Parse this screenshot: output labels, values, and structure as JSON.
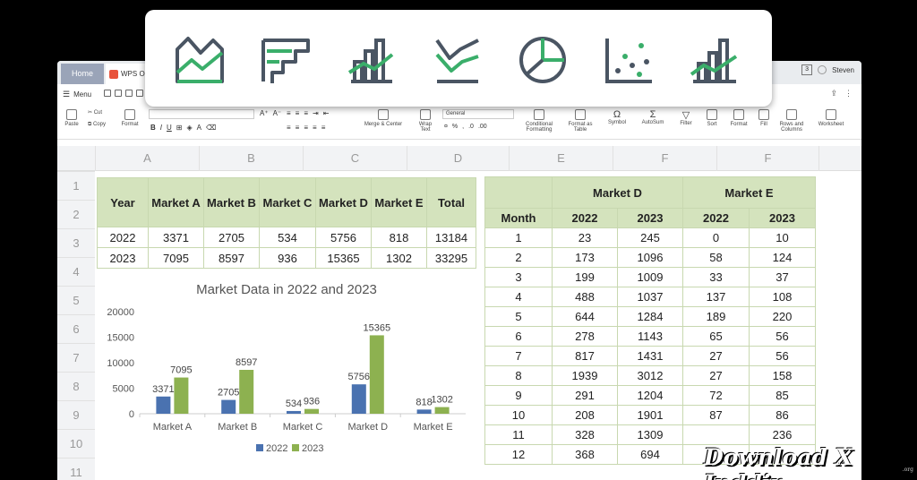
{
  "tabs": {
    "home": "Home",
    "wps": "WPS O"
  },
  "user": {
    "badge": "3",
    "name": "Steven"
  },
  "menu": {
    "label": "Menu"
  },
  "toolbar": {
    "paste": "Paste",
    "cut": "Cut",
    "copy": "Copy",
    "format": "Format",
    "merge_center": "Merge & Center",
    "wrap_text": "Wrap Text",
    "number_format": "General",
    "conditional_formatting": "Conditional Formatting",
    "format_as_table": "Format as Table",
    "symbol": "Symbol",
    "autosum": "AutoSum",
    "filter": "Filter",
    "sort": "Sort",
    "format2": "Format",
    "fill": "Fill",
    "rows_columns": "Rows and Columns",
    "worksheet": "Worksheet"
  },
  "columns": [
    "A",
    "B",
    "C",
    "D",
    "E",
    "F",
    "F"
  ],
  "rows": [
    "1",
    "2",
    "3",
    "4",
    "5",
    "6",
    "7",
    "8",
    "9",
    "10",
    "11"
  ],
  "table_left": {
    "headers": [
      "Year",
      "Market A",
      "Market B",
      "Market C",
      "Market D",
      "Market E",
      "Total"
    ],
    "rows": [
      [
        "2022",
        "3371",
        "2705",
        "534",
        "5756",
        "818",
        "13184"
      ],
      [
        "2023",
        "7095",
        "8597",
        "936",
        "15365",
        "1302",
        "33295"
      ]
    ]
  },
  "table_right": {
    "group_headers": [
      "Market D",
      "Market E"
    ],
    "sub_headers": [
      "Month",
      "2022",
      "2023",
      "2022",
      "2023"
    ],
    "rows": [
      [
        "1",
        "23",
        "245",
        "0",
        "10"
      ],
      [
        "2",
        "173",
        "1096",
        "58",
        "124"
      ],
      [
        "3",
        "199",
        "1009",
        "33",
        "37"
      ],
      [
        "4",
        "488",
        "1037",
        "137",
        "108"
      ],
      [
        "5",
        "644",
        "1284",
        "189",
        "220"
      ],
      [
        "6",
        "278",
        "1143",
        "65",
        "56"
      ],
      [
        "7",
        "817",
        "1431",
        "27",
        "56"
      ],
      [
        "8",
        "1939",
        "3012",
        "27",
        "158"
      ],
      [
        "9",
        "291",
        "1204",
        "72",
        "85"
      ],
      [
        "10",
        "208",
        "1901",
        "87",
        "86"
      ],
      [
        "11",
        "328",
        "1309",
        "",
        "236"
      ],
      [
        "12",
        "368",
        "694",
        "",
        ""
      ]
    ]
  },
  "chart_data": {
    "type": "bar",
    "title": "Market Data in 2022 and 2023",
    "categories": [
      "Market A",
      "Market B",
      "Market C",
      "Market D",
      "Market E"
    ],
    "series": [
      {
        "name": "2022",
        "values": [
          3371,
          2705,
          534,
          5756,
          818
        ],
        "color": "#4a72b0"
      },
      {
        "name": "2023",
        "values": [
          7095,
          8597,
          936,
          15365,
          1302
        ],
        "color": "#8db150"
      }
    ],
    "yticks": [
      "0",
      "5000",
      "10000",
      "15000",
      "20000"
    ],
    "ylim": [
      0,
      20000
    ],
    "legend": "bottom"
  },
  "colors": {
    "accent_green": "#3aae6a",
    "icon_gray": "#4a5563",
    "header_green": "#d4e3bd"
  },
  "icons": [
    "area-chart-icon",
    "bar-chart-icon",
    "combo-chart-icon",
    "line-chart-icon",
    "pie-chart-icon",
    "scatter-chart-icon",
    "combo-chart-2-icon"
  ],
  "watermark": {
    "text": "Download X Inddir",
    "sub": ".org"
  }
}
